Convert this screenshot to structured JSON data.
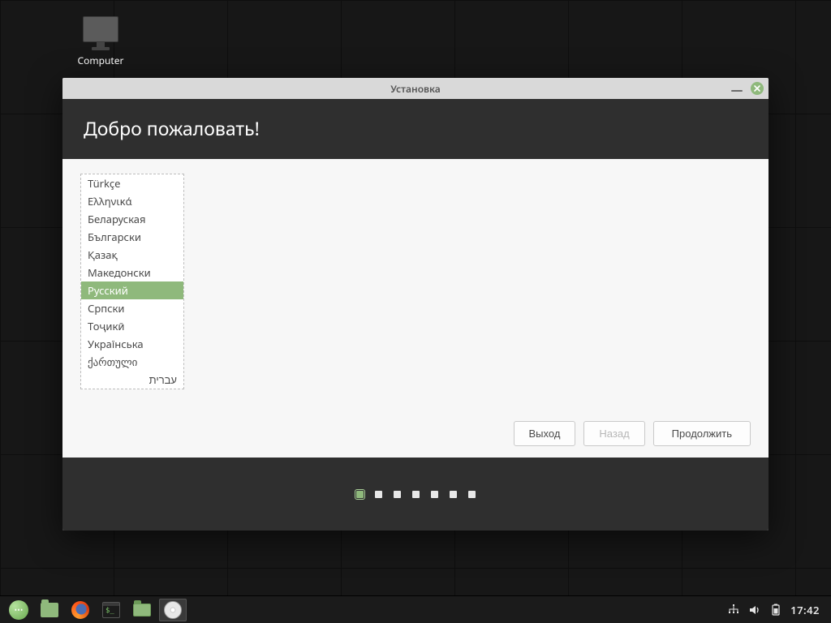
{
  "desktop": {
    "computer_label": "Computer"
  },
  "window": {
    "title": "Установка",
    "heading": "Добро пожаловать!"
  },
  "languages": [
    "Türkçe",
    "Ελληνικά",
    "Беларуская",
    "Български",
    "Қазақ",
    "Македонски",
    "Русский",
    "Српски",
    "Тоҷикӣ",
    "Українська",
    "ქართული",
    "עברית"
  ],
  "selected_language_index": 6,
  "buttons": {
    "quit": "Выход",
    "back": "Назад",
    "continue": "Продолжить"
  },
  "progress": {
    "total_dots": 7,
    "active_index": 0
  },
  "taskbar": {
    "clock": "17:42"
  },
  "colors": {
    "accent": "#8fb97c",
    "window_header": "#2f2f2f"
  }
}
